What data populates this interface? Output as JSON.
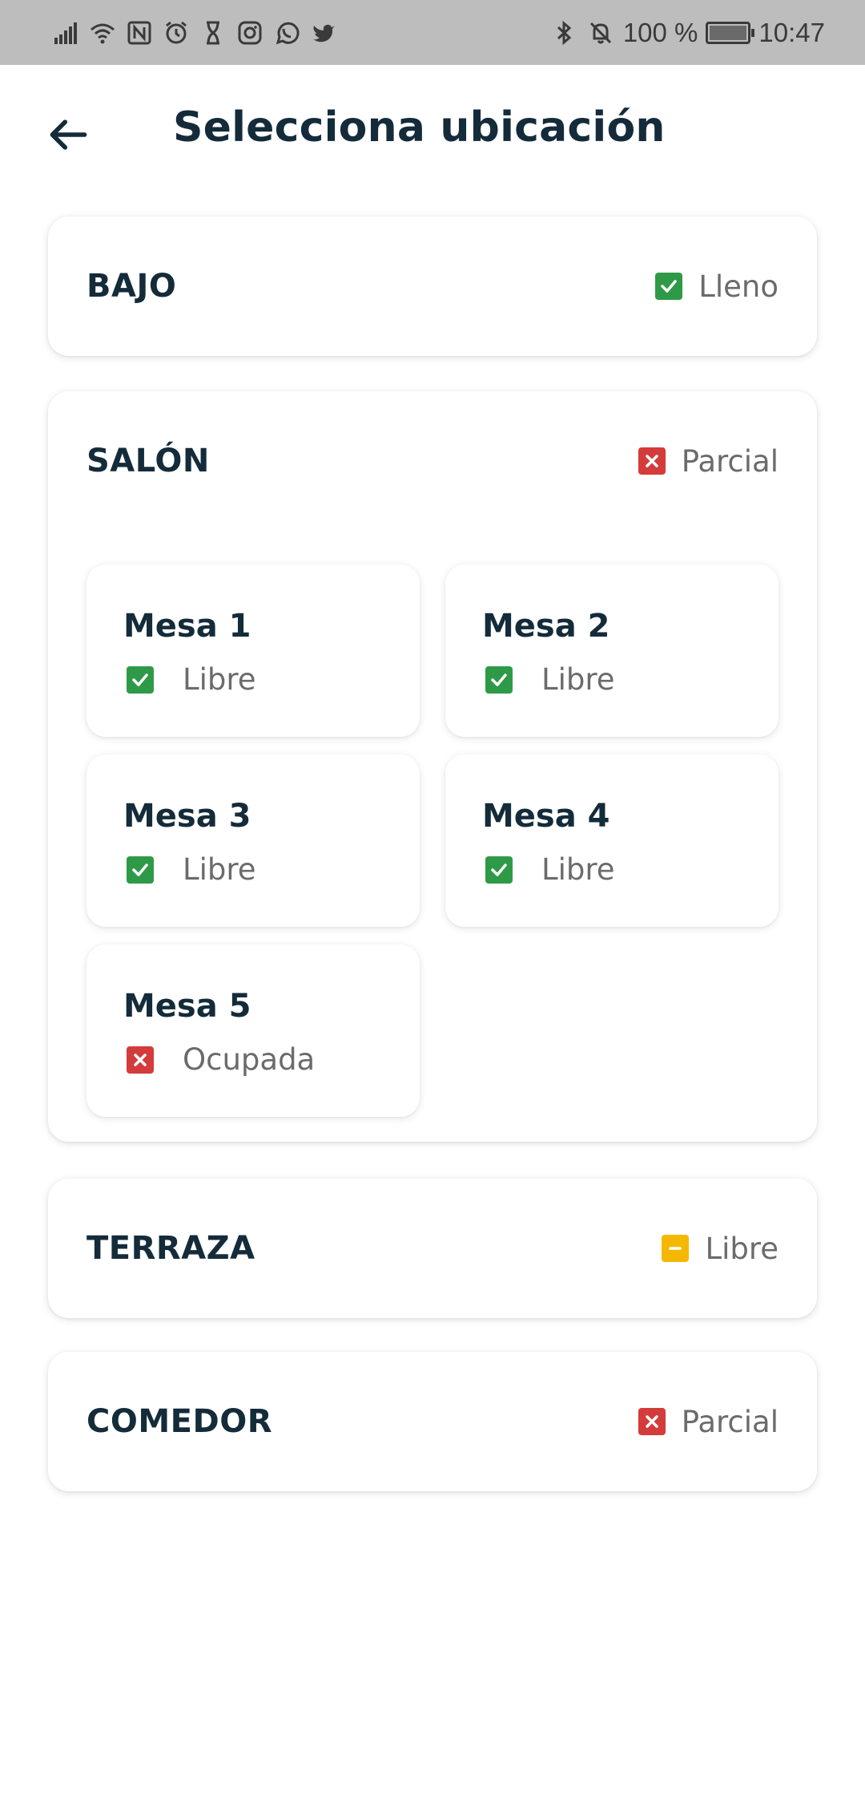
{
  "status_bar": {
    "left_icons": [
      "signal-icon",
      "wifi-icon",
      "nfc-icon",
      "alarm-icon",
      "hourglass-icon",
      "instagram-icon",
      "whatsapp-icon",
      "twitter-icon"
    ],
    "battery_percent": "100 %",
    "time": "10:47"
  },
  "header": {
    "title": "Selecciona ubicación",
    "back_icon": "arrow-left-icon"
  },
  "colors": {
    "ok": "#2e9a47",
    "error": "#d43b3b",
    "warning": "#f5b800",
    "text_dark": "#142b3a",
    "text_muted": "#6b6b6b"
  },
  "zones": [
    {
      "name": "BAJO",
      "status": "Lleno",
      "icon": "check-icon",
      "color": "green"
    },
    {
      "name": "SALÓN",
      "status": "Parcial",
      "icon": "cross-icon",
      "color": "red",
      "tables": [
        {
          "name": "Mesa 1",
          "status": "Libre",
          "icon": "check-icon",
          "color": "green"
        },
        {
          "name": "Mesa 2",
          "status": "Libre",
          "icon": "check-icon",
          "color": "green"
        },
        {
          "name": "Mesa 3",
          "status": "Libre",
          "icon": "check-icon",
          "color": "green"
        },
        {
          "name": "Mesa 4",
          "status": "Libre",
          "icon": "check-icon",
          "color": "green"
        },
        {
          "name": "Mesa 5",
          "status": "Ocupada",
          "icon": "cross-icon",
          "color": "red"
        }
      ]
    },
    {
      "name": "TERRAZA",
      "status": "Libre",
      "icon": "minus-icon",
      "color": "yellow"
    },
    {
      "name": "COMEDOR",
      "status": "Parcial",
      "icon": "cross-icon",
      "color": "red"
    }
  ]
}
